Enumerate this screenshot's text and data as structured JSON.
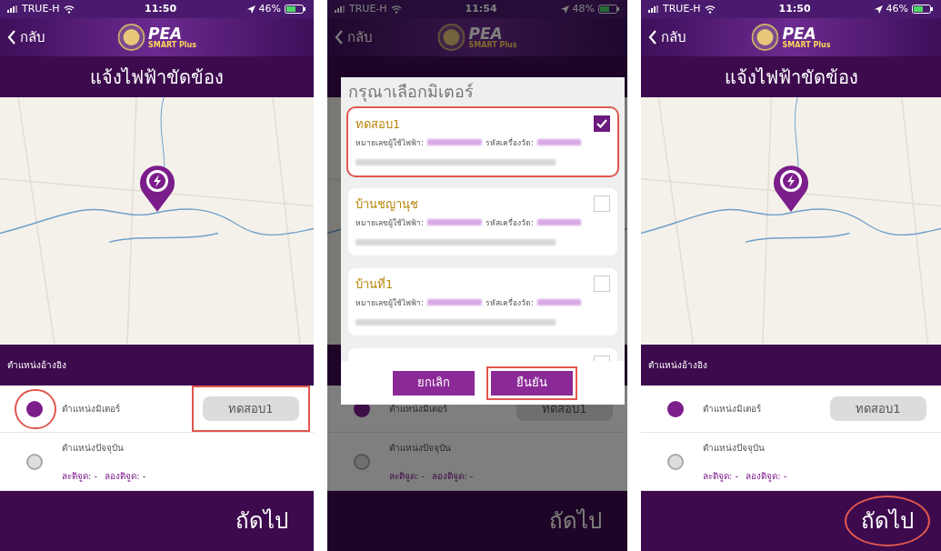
{
  "screens": [
    {
      "status_bar": {
        "carrier": "TRUE-H",
        "time": "11:50",
        "battery": "46%"
      },
      "back": "กลับ",
      "logo": {
        "text": "PEA",
        "sub": "SMART Plus"
      },
      "title": "แจ้งไฟฟ้าขัดข้อง",
      "section": "ตำแหน่งอ้างอิง",
      "options": [
        {
          "kind": "value",
          "label": "ตำแหน่งมิเตอร์",
          "selected": true,
          "value": "ทดสอบ1",
          "highlight": true
        },
        {
          "kind": "coords",
          "label": "ตำแหน่งปัจจุบัน",
          "selected": false,
          "lat": "ละติจูด: -",
          "lng": "ลองติจูด: -",
          "highlight": false
        }
      ],
      "next": {
        "label": "ถัดไป",
        "highlight": false
      }
    },
    {
      "status_bar": {
        "carrier": "TRUE-H",
        "time": "11:54",
        "battery": "48%"
      },
      "back": "กลับ",
      "logo": {
        "text": "PEA",
        "sub": "SMART Plus"
      },
      "options": [
        {
          "kind": "value",
          "label": "ตำแหน่งมิเตอร์",
          "selected": true,
          "value": "ทดสอบ1",
          "highlight": false
        },
        {
          "kind": "coords",
          "label": "ตำแหน่งปัจจุบัน",
          "selected": false,
          "lat": "ละติจูด: -",
          "lng": "ลองติจูด: -",
          "highlight": false
        }
      ],
      "next": {
        "label": "ถัดไป",
        "highlight": false
      },
      "dialog": {
        "title": "กรุณาเลือกมิเตอร์",
        "meters": [
          {
            "name": "ทดสอบ1",
            "ca_label": "หมายเลขผู้ใช้ไฟฟ้า:",
            "meter_label": "รหัสเครื่องวัด:",
            "checked": true,
            "highlight": true
          },
          {
            "name": "บ้านชญานุช",
            "ca_label": "หมายเลขผู้ใช้ไฟฟ้า:",
            "meter_label": "รหัสเครื่องวัด:",
            "checked": false,
            "highlight": false
          },
          {
            "name": "บ้านที่1",
            "ca_label": "หมายเลขผู้ใช้ไฟฟ้า:",
            "meter_label": "รหัสเครื่องวัด:",
            "checked": false,
            "highlight": false
          },
          {
            "checked": false,
            "highlight": false
          }
        ],
        "buttons": [
          {
            "label": "ยกเลิก",
            "highlight": false
          },
          {
            "label": "ยืนยัน",
            "highlight": true
          }
        ]
      }
    },
    {
      "status_bar": {
        "carrier": "TRUE-H",
        "time": "11:50",
        "battery": "46%"
      },
      "back": "กลับ",
      "logo": {
        "text": "PEA",
        "sub": "SMART Plus"
      },
      "title": "แจ้งไฟฟ้าขัดข้อง",
      "section": "ตำแหน่งอ้างอิง",
      "options": [
        {
          "kind": "value",
          "label": "ตำแหน่งมิเตอร์",
          "selected": true,
          "value": "ทดสอบ1",
          "highlight": false
        },
        {
          "kind": "coords",
          "label": "ตำแหน่งปัจจุบัน",
          "selected": false,
          "lat": "ละติจูด: -",
          "lng": "ลองติจูด: -",
          "highlight": false
        }
      ],
      "next": {
        "label": "ถัดไป",
        "highlight": true
      }
    }
  ]
}
